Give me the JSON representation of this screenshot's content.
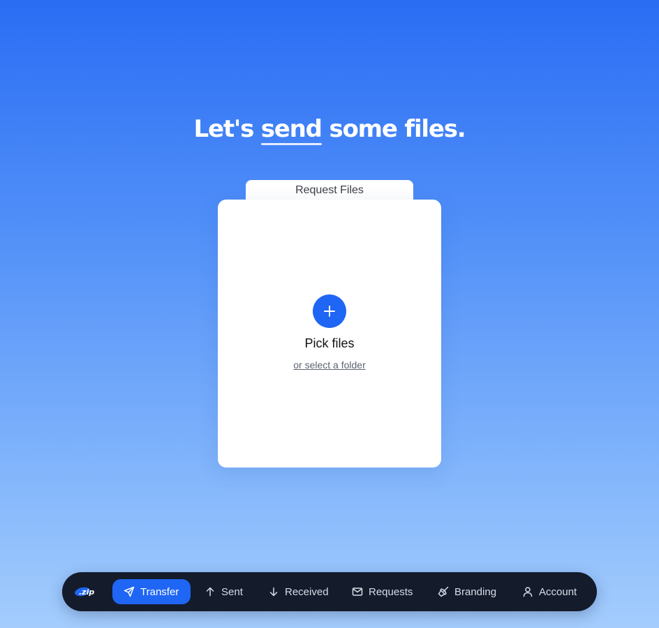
{
  "headline": {
    "prefix": "Let's",
    "emphasis": "send",
    "suffix": "some files."
  },
  "upload": {
    "tab_label": "Request Files",
    "add_icon": "plus-icon",
    "pick_label": "Pick files",
    "folder_link": "or select a folder"
  },
  "nav": {
    "logo_text": ".zip",
    "items": [
      {
        "label": "Transfer",
        "icon": "send-icon",
        "active": true
      },
      {
        "label": "Sent",
        "icon": "arrow-up-icon",
        "active": false
      },
      {
        "label": "Received",
        "icon": "arrow-down-icon",
        "active": false
      },
      {
        "label": "Requests",
        "icon": "mail-icon",
        "active": false
      },
      {
        "label": "Branding",
        "icon": "brush-icon",
        "active": false
      },
      {
        "label": "Account",
        "icon": "user-icon",
        "active": false
      }
    ]
  },
  "colors": {
    "accent": "#1f66f4",
    "nav_background": "#141b2b",
    "page_gradient_top": "#2a6df4",
    "page_gradient_bottom": "#a4cdfd"
  }
}
